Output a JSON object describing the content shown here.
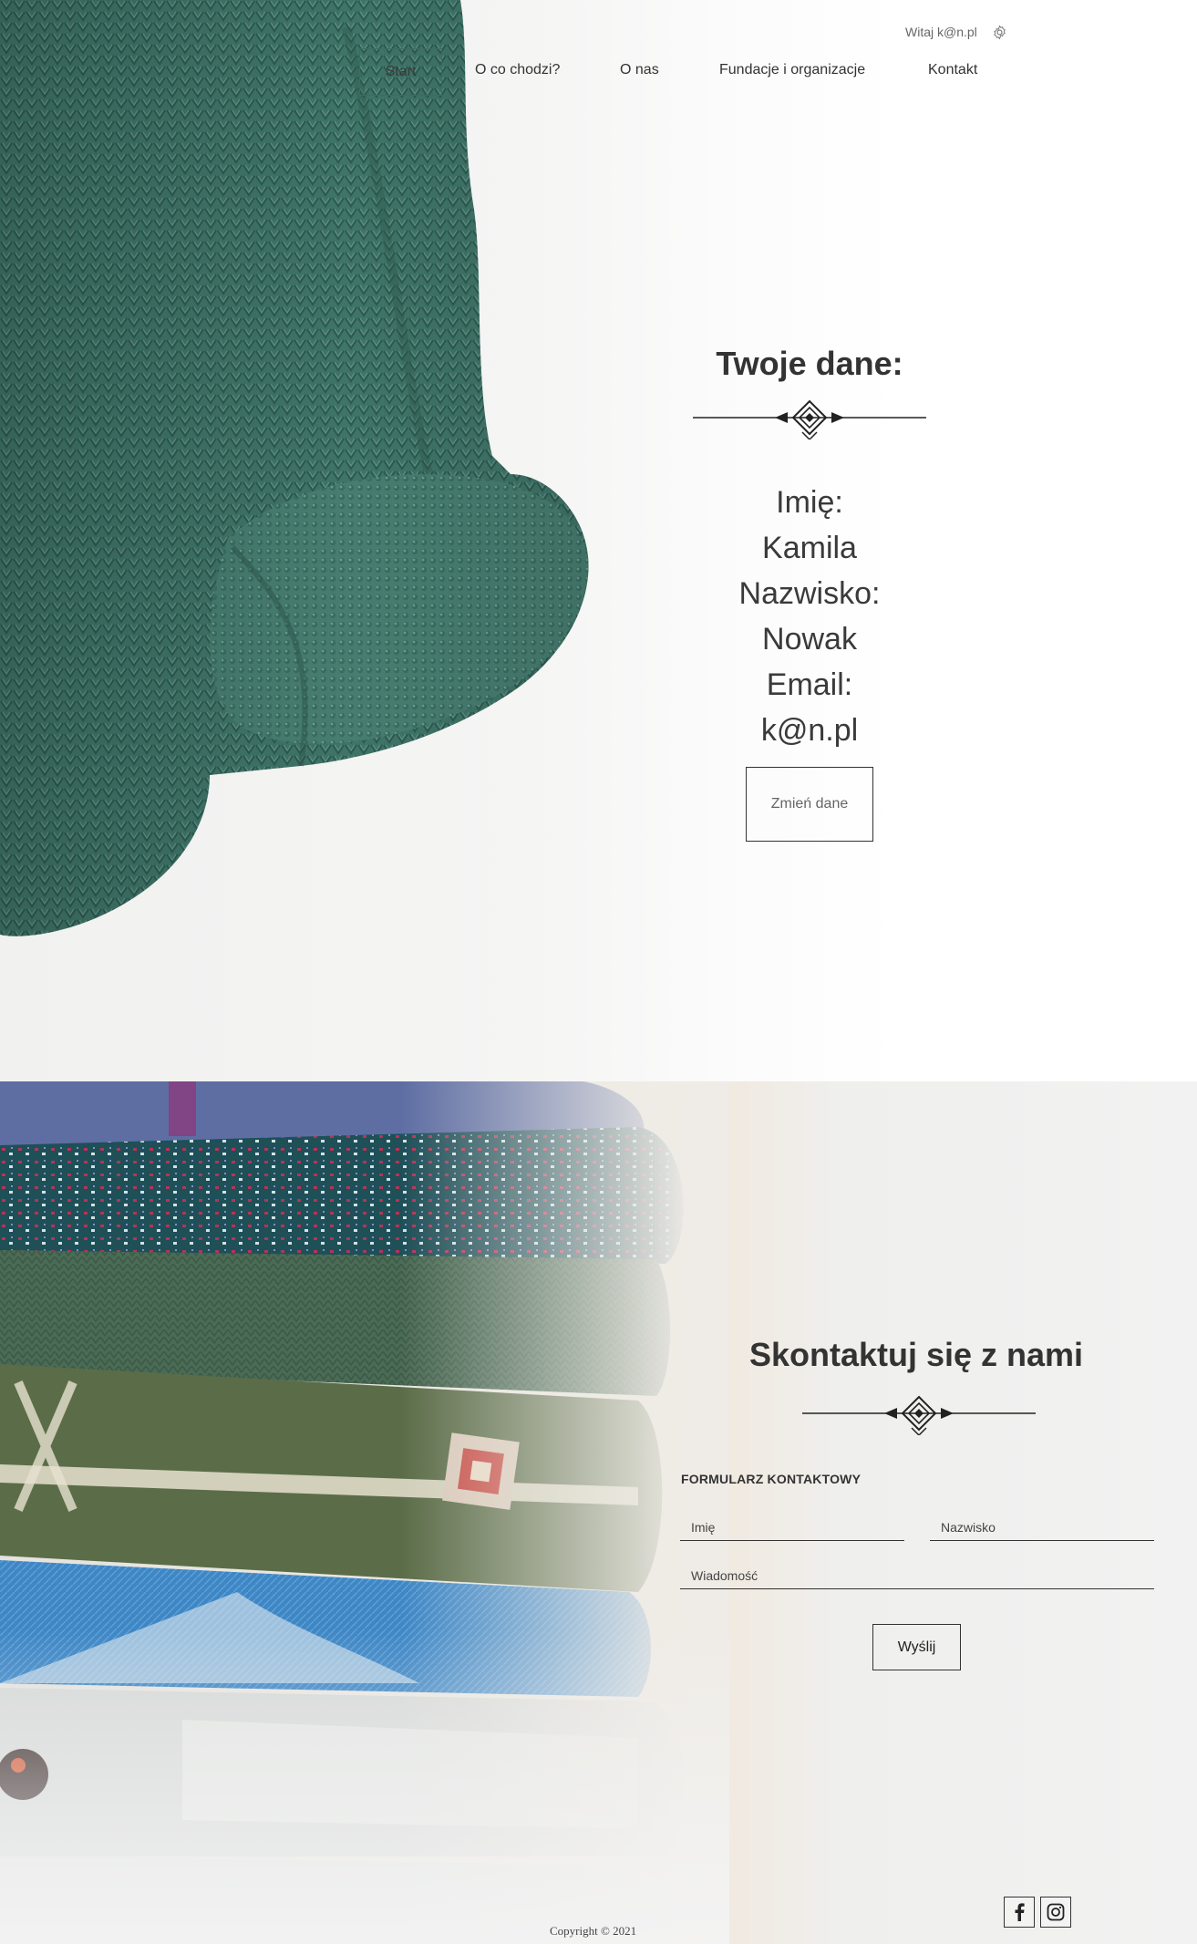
{
  "header": {
    "greeting": "Witaj k@n.pl",
    "settings_icon": "gear-icon",
    "nav": {
      "start_label": "Start",
      "items": [
        {
          "label": "O co chodzi?"
        },
        {
          "label": "O nas"
        },
        {
          "label": "Fundacje i organizacje"
        },
        {
          "label": "Kontakt"
        }
      ]
    }
  },
  "profile": {
    "title": "Twoje dane:",
    "first_name_label": "Imię:",
    "first_name": "Kamila",
    "last_name_label": "Nazwisko:",
    "last_name": "Nowak",
    "email_label": "Email:",
    "email": "k@n.pl",
    "change_button": "Zmień dane"
  },
  "contact": {
    "title": "Skontaktuj się z nami",
    "form_label": "FORMULARZ KONTAKTOWY",
    "first_name_placeholder": "Imię",
    "last_name_placeholder": "Nazwisko",
    "message_placeholder": "Wiadomość",
    "send_button": "Wyślij"
  },
  "footer": {
    "copyright": "Copyright © 2021",
    "social": [
      {
        "icon": "facebook-icon"
      },
      {
        "icon": "instagram-icon"
      }
    ]
  },
  "colors": {
    "accent": "#3d6b62",
    "text": "#333333"
  }
}
